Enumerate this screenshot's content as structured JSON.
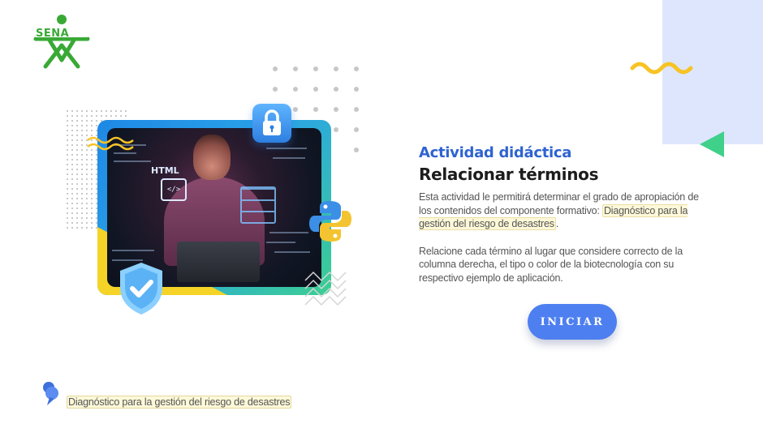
{
  "logo": {
    "text": "SENA",
    "color": "#39a935"
  },
  "colors": {
    "accent": "#4d7ff0",
    "title_blue": "#2f63d0",
    "highlight": "#fdf8d8",
    "panel": "#dde6fd",
    "yellow": "#f7c325",
    "green": "#3ccf91"
  },
  "hero": {
    "icons": [
      "lock-icon",
      "python-logo-icon",
      "shield-check-icon",
      "html-code-icon"
    ],
    "html_label": "HTML",
    "html_tag": "</>"
  },
  "activity": {
    "label": "Actividad didáctica",
    "title": "Relacionar términos",
    "intro": "Esta actividad le permitirá determinar el grado de apropiación de los contenidos del componente formativo:",
    "topic": "Diagnóstico para la gestión del riesgo de desastres",
    "topic_suffix": ".",
    "instructions": "Relacione cada término al lugar que considere correcto de la columna derecha, el tipo o color de la biotecnología con su respectivo ejemplo de aplicación."
  },
  "start_button": {
    "label": "INICIAR"
  },
  "footer": {
    "topic_link": "Diagnóstico para la gestión del riesgo de desastres",
    "icon": "pin-icon"
  }
}
